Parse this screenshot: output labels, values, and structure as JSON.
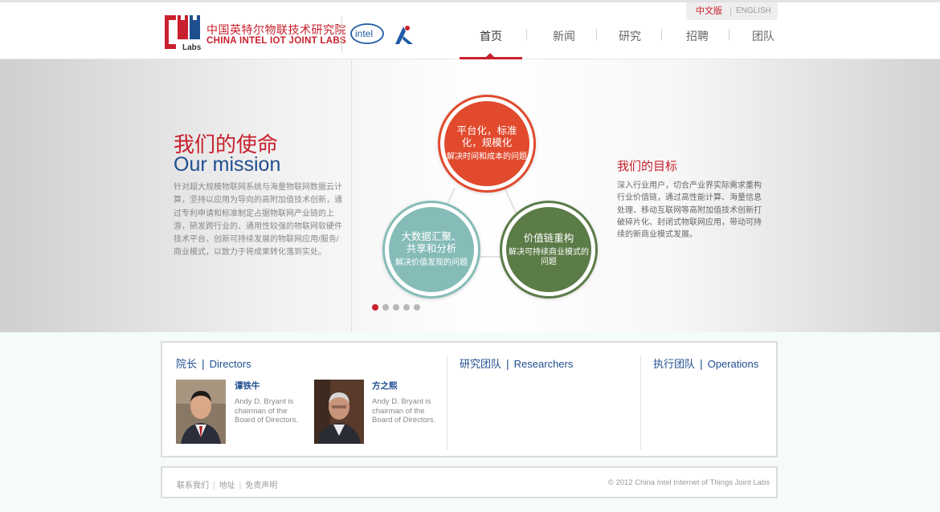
{
  "header": {
    "logo_text": "Labs",
    "org_name_cn": "中国英特尔物联技术研究院",
    "org_name_en": "CHINA INTEL IOT JOINT LABS",
    "intel_logo_text": "intel",
    "languages": {
      "cn": "中文版",
      "separator": "|",
      "en": "ENGLISH",
      "active": "中文版"
    },
    "nav": [
      {
        "label": "首页",
        "active": true
      },
      {
        "label": "新闻",
        "active": false
      },
      {
        "label": "研究",
        "active": false
      },
      {
        "label": "招聘",
        "active": false
      },
      {
        "label": "团队",
        "active": false
      }
    ]
  },
  "banner": {
    "mission_title_cn": "我们的使命",
    "mission_title_en": "Our mission",
    "mission_text": "针对超大规模物联网系统与海量物联网数据云计算，坚持以应用为导向的高附加值技术创新，通过专利申请和标准制定占据物联网产业链的上游，研发跨行业的、通用性较强的物联网软硬件技术平台，创新可持续发展的物联网应用/服务/商业模式，以致力于将成果转化落到实处。",
    "circles": {
      "top": {
        "title": "平台化，标准化，规模化",
        "subtitle": "解决时间和成本的问题",
        "color": "#e14a2d"
      },
      "left": {
        "title": "大数据汇聚、共享和分析",
        "subtitle": "解决价值发现的问题",
        "color": "#86bcb8"
      },
      "right": {
        "title": "价值链重构",
        "subtitle": "解决可持续商业模式的问题",
        "color": "#5b7b47"
      }
    },
    "slider": {
      "count": 5,
      "active": 1
    },
    "goal_title": "我们的目标",
    "goal_text": "深入行业用户，切合产业界实际需求重构行业价值链，通过高性能计算、海量信息处理、移动互联网等高附加值技术创新打破碎片化、封闭式物联网应用，带动可持续的新商业模式发展。"
  },
  "team": {
    "directors": {
      "cn": "院长",
      "en": "Directors",
      "people": [
        {
          "name": "谭铁牛",
          "desc": "Andy D. Bryant is chairman of the Board of Directors."
        },
        {
          "name": "方之熙",
          "desc": "Andy D. Bryant is chairman of the Board of Directors."
        }
      ]
    },
    "researchers": {
      "cn": "研究团队",
      "en": "Researchers"
    },
    "operations": {
      "cn": "执行团队",
      "en": "Operations"
    },
    "separator": "|"
  },
  "footer": {
    "links": [
      "联系我们",
      "地址",
      "免责声明"
    ],
    "separator": "|",
    "copyright": "© 2012 China Intel Internet of Things Joint Labs"
  },
  "colors": {
    "brand_red": "#c8202d",
    "brand_blue": "#1f4e8f",
    "circle_red": "#e14a2d",
    "circle_teal": "#86bcb8",
    "circle_green": "#5b7b47"
  }
}
